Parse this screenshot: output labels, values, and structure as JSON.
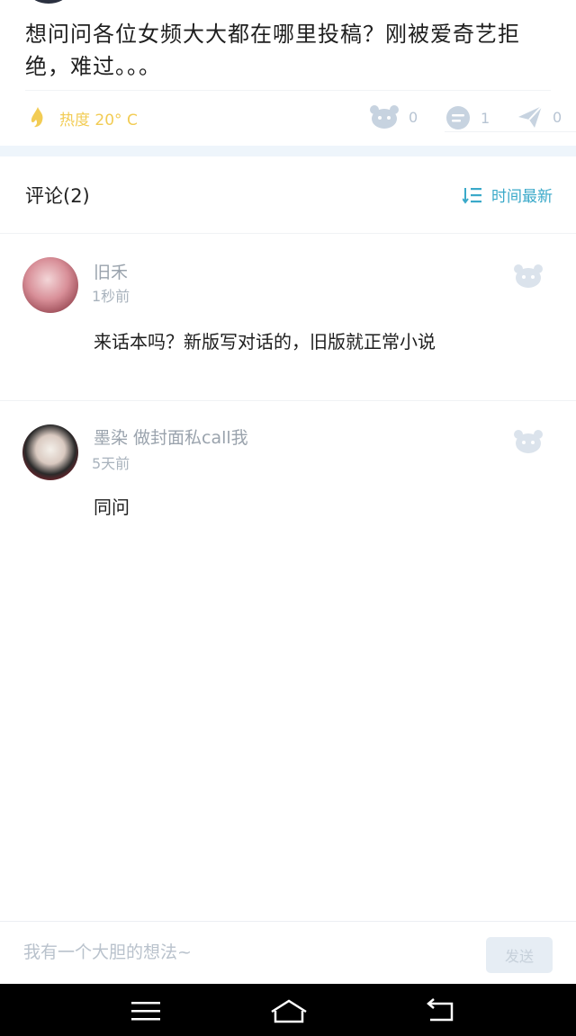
{
  "post": {
    "title": "想问问各位女频大大都在哪里投稿？刚被爱奇艺拒绝，难过。。。"
  },
  "stats": {
    "heat_label": "热度 20° C",
    "likes": "0",
    "comments": "1",
    "shares": "0"
  },
  "comments_section": {
    "title": "评论(2)",
    "sort_label": "时间最新",
    "items": [
      {
        "username": "旧禾",
        "time": "1秒前",
        "text": "来话本吗？新版写对话的，旧版就正常小说"
      },
      {
        "username": "墨染 做封面私call我",
        "time": "5天前",
        "text": "同问"
      }
    ]
  },
  "input": {
    "placeholder": "我有一个大胆的想法~",
    "send_label": "发送"
  },
  "colors": {
    "accent": "#3aa9c9",
    "heat": "#f2cc54",
    "muted": "#b7c4d3",
    "band": "#eef5fb"
  },
  "icons": {
    "heat": "flame-icon",
    "like": "paw-like-icon",
    "comment": "comment-bubble-icon",
    "share": "paper-plane-icon",
    "sort": "sort-icon",
    "nav_menu": "menu-icon",
    "nav_home": "home-icon",
    "nav_back": "back-icon"
  }
}
